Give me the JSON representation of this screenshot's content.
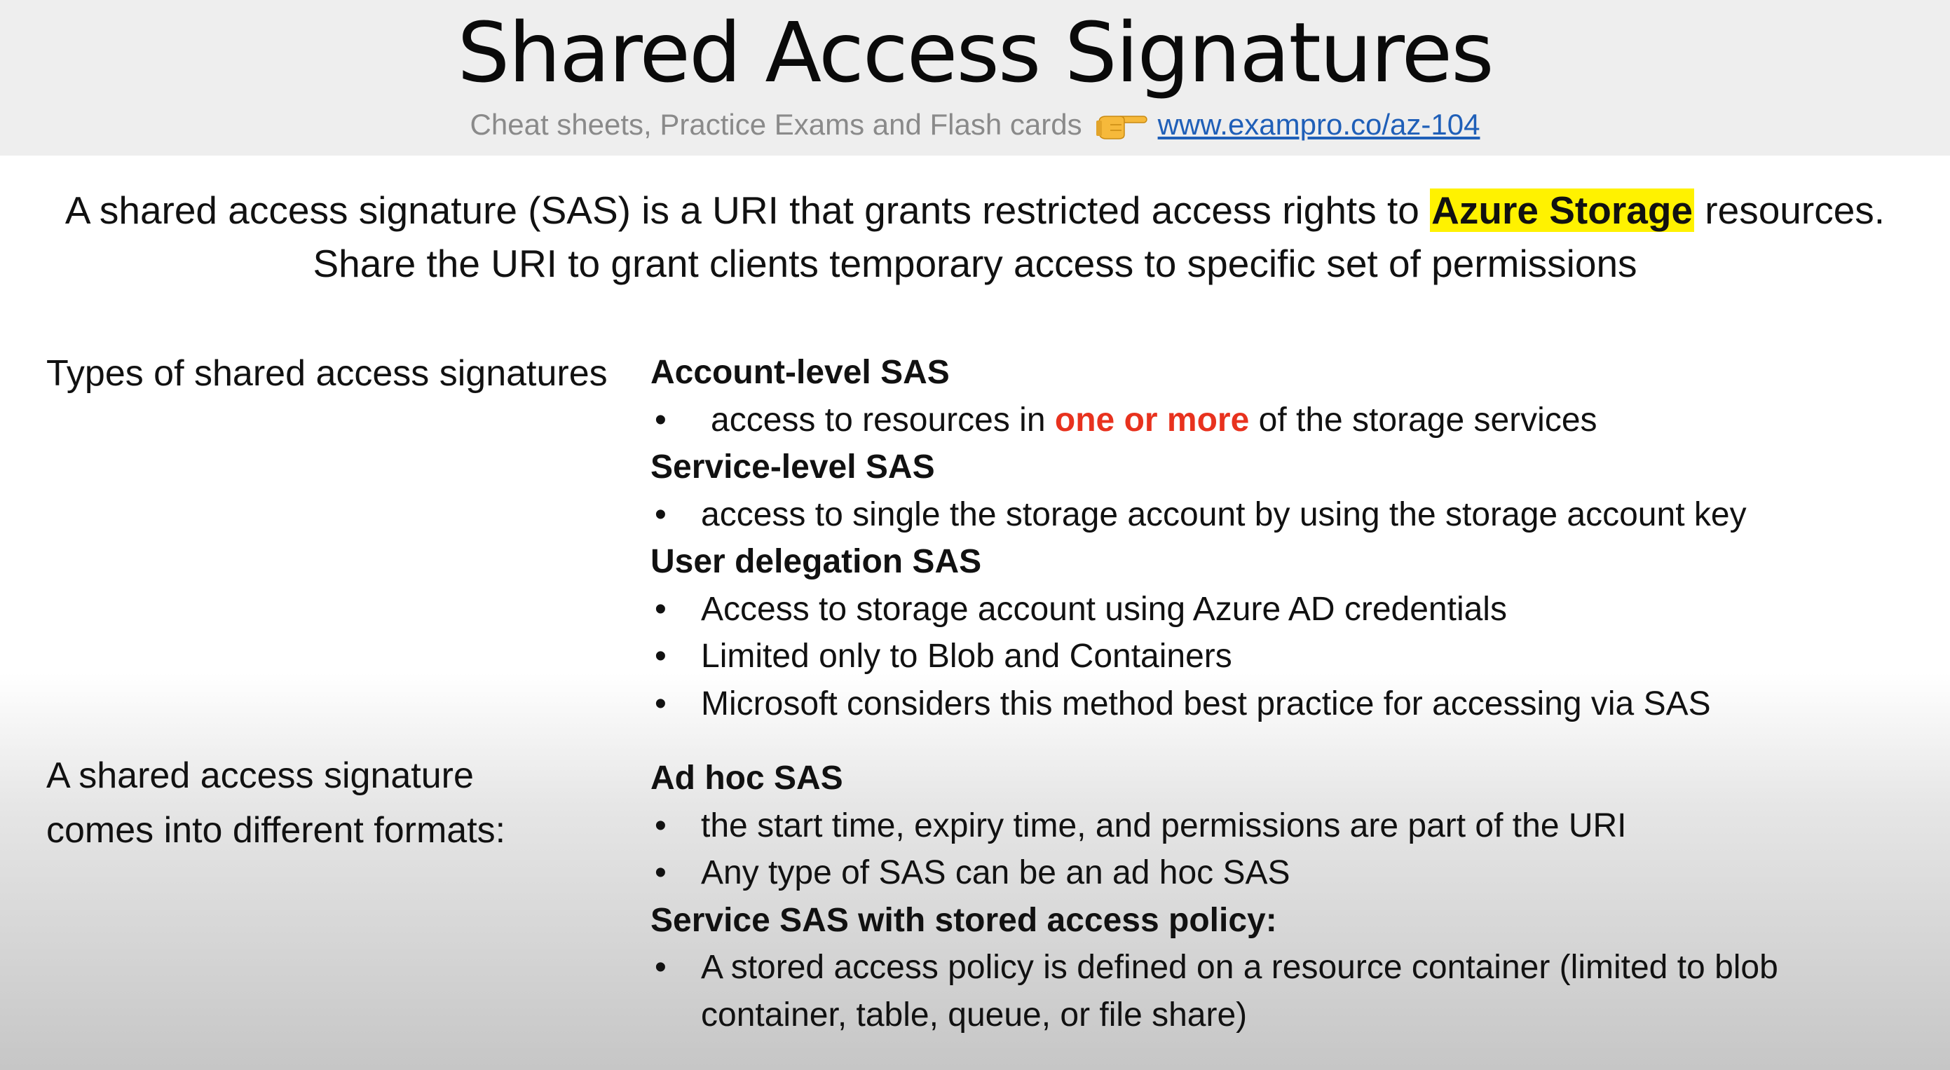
{
  "header": {
    "title": "Shared Access Signatures",
    "subtitle": "Cheat sheets, Practice Exams and Flash cards",
    "pointer_icon": "pointing-hand-icon",
    "link": "www.exampro.co/az-104"
  },
  "intro": {
    "line1_before": "A shared access signature (SAS) is a URI that grants restricted access rights to",
    "line1_highlight": "Azure Storage",
    "line1_after": "resources.",
    "line2": "Share the URI to grant clients temporary access to specific set of permissions",
    "highlight_color": "#fff200"
  },
  "types": {
    "label": "Types of shared access signatures",
    "account": {
      "heading": "Account-level SAS",
      "bullet_before": "access to resources in",
      "bullet_emphasis": "one or more",
      "bullet_after": "of the storage services",
      "emphasis_color": "#e8321e"
    },
    "service": {
      "heading": "Service-level SAS",
      "bullets": [
        "access to single the storage account by using the storage account key"
      ]
    },
    "user_delegation": {
      "heading": "User delegation SAS",
      "bullets": [
        "Access to storage account using Azure AD credentials",
        "Limited only to Blob and Containers",
        "Microsoft considers this method best practice for accessing via SAS"
      ]
    }
  },
  "formats": {
    "label_line1": "A shared access signature",
    "label_line2": "comes into different formats:",
    "adhoc": {
      "heading": "Ad hoc SAS",
      "bullets": [
        "the start time, expiry time, and permissions are part of the URI",
        "Any type of SAS can be an ad hoc SAS"
      ]
    },
    "stored": {
      "heading": "Service SAS with stored access policy:",
      "bullet_line1": "A stored access policy is defined on a resource container (limited to blob",
      "bullet_line2": "container, table, queue, or file share)"
    }
  },
  "bullet_char": "•"
}
